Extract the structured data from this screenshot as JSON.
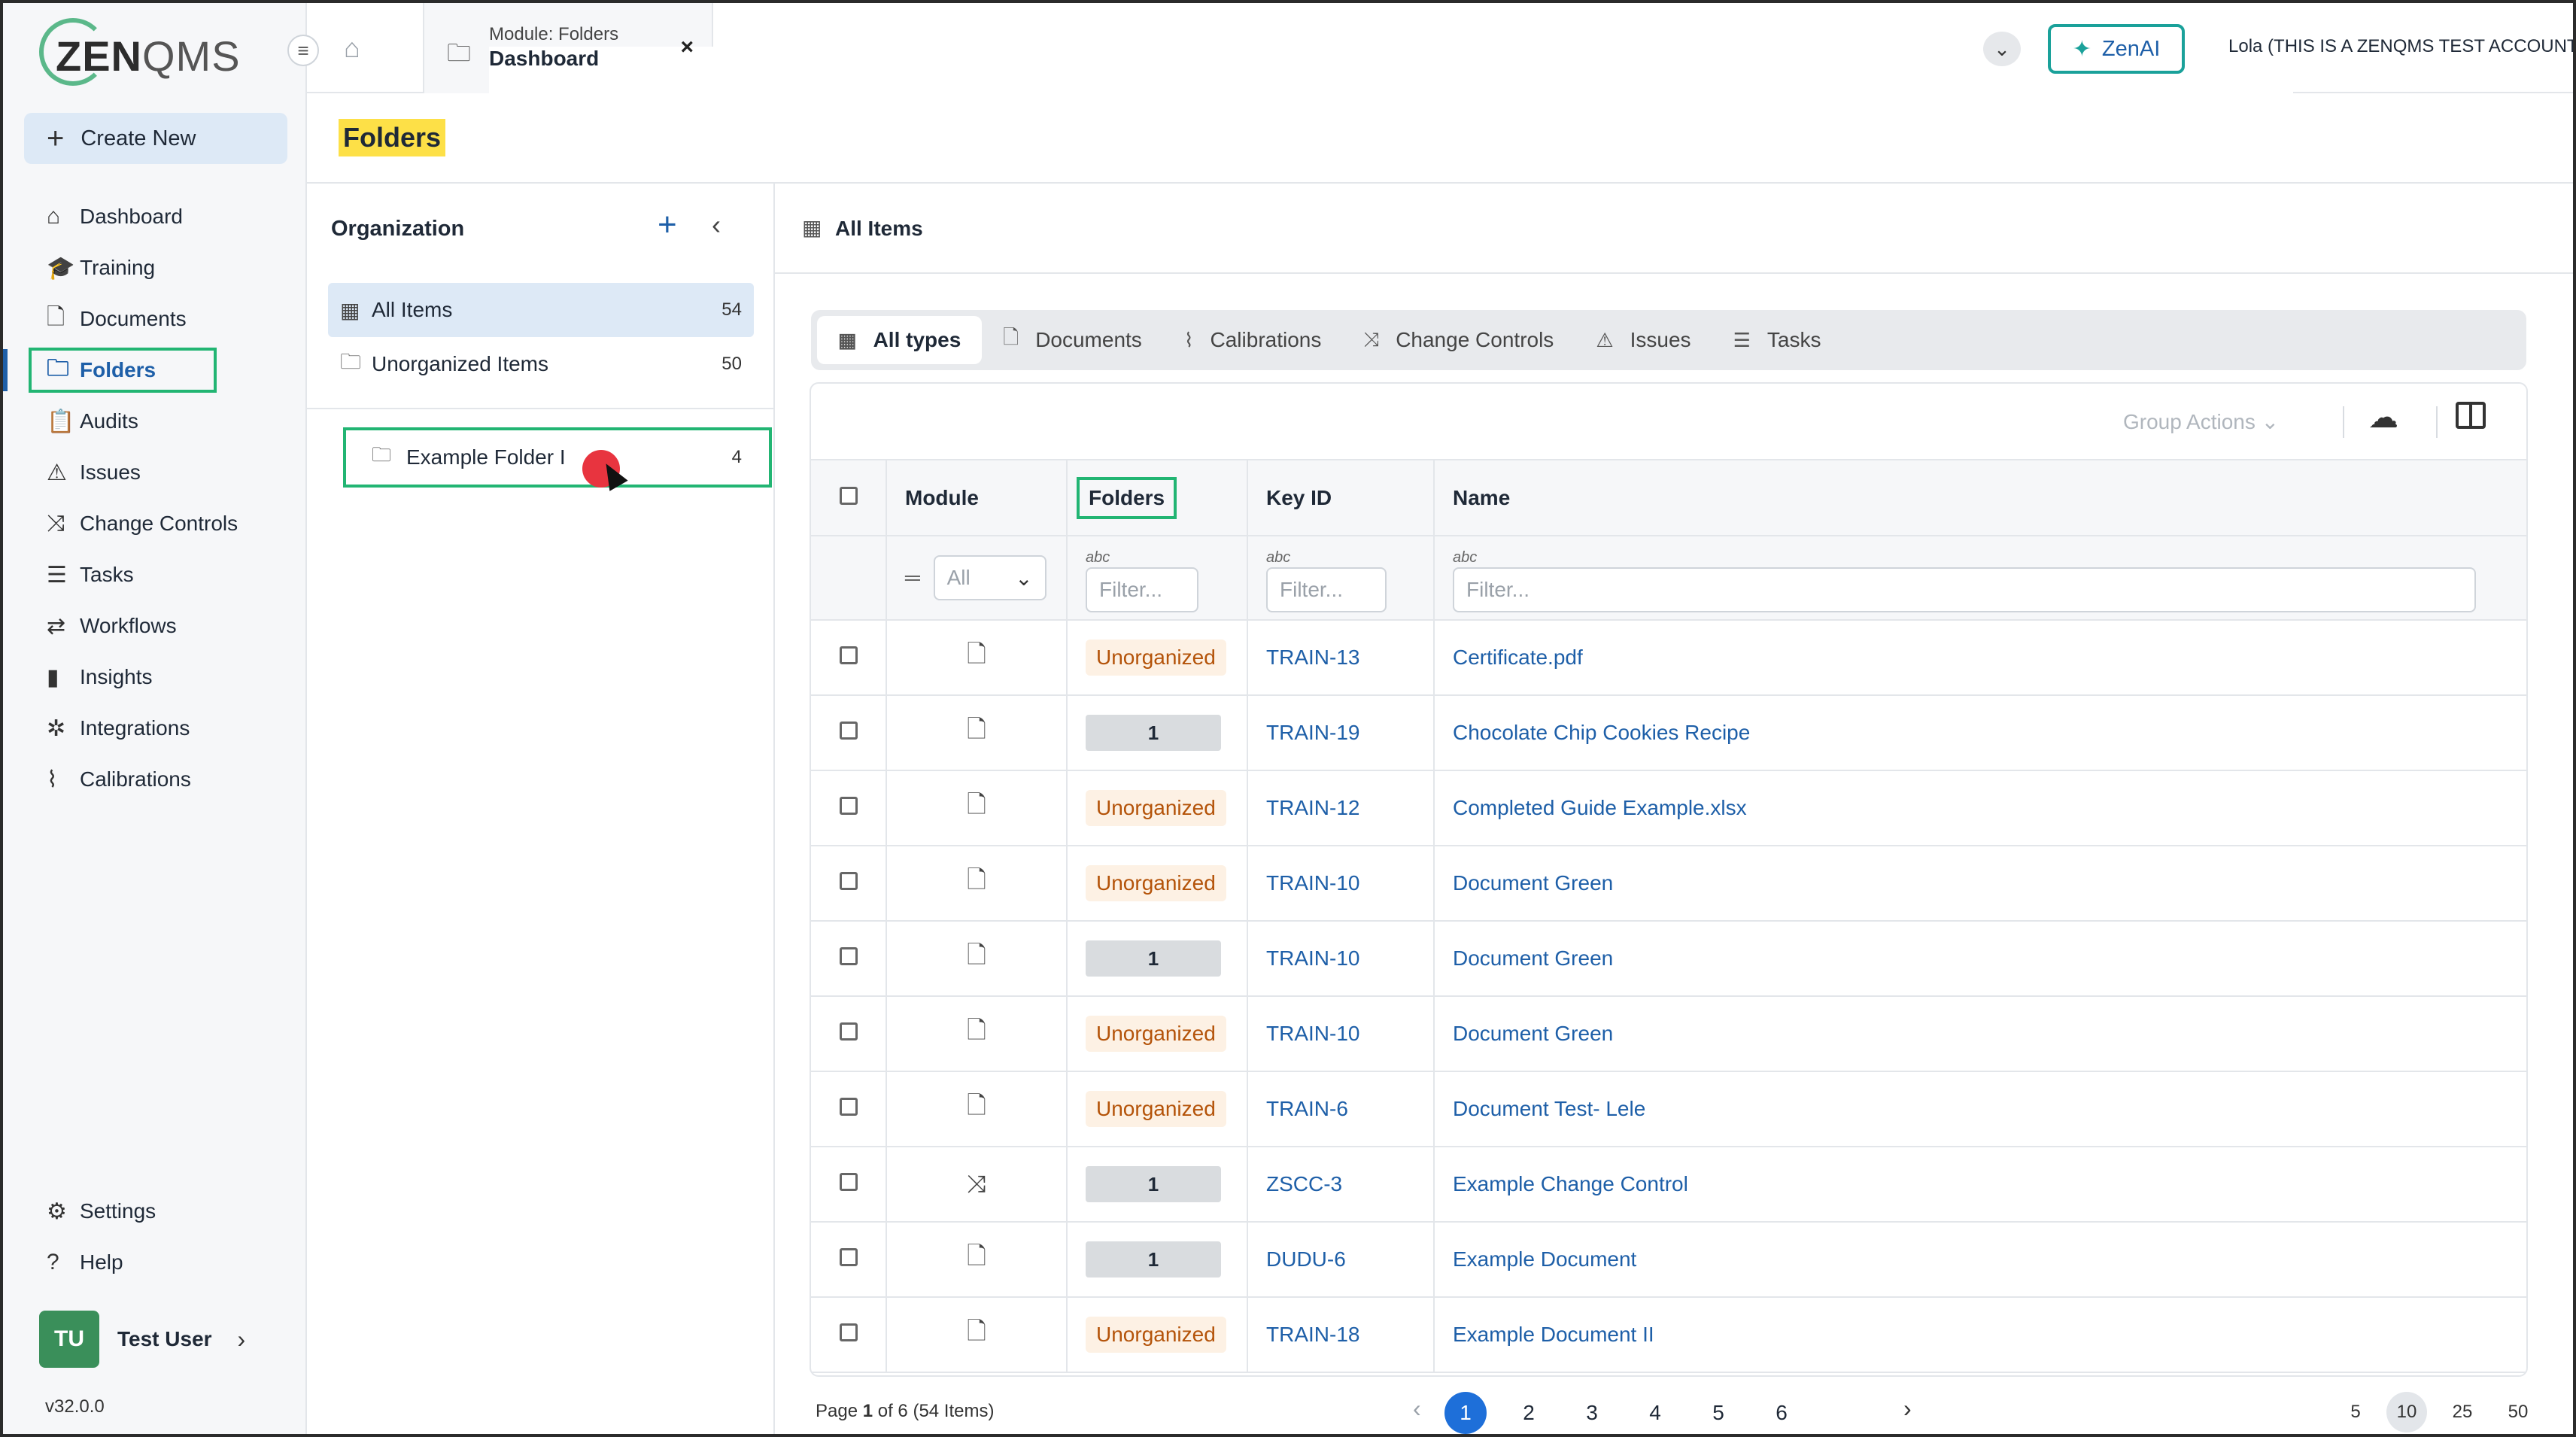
{
  "brand": {
    "logo_main": "ZEN",
    "logo_light": "QMS"
  },
  "sidebar": {
    "create_new": "Create New",
    "items": [
      {
        "label": "Dashboard",
        "icon": "home-icon"
      },
      {
        "label": "Training",
        "icon": "graduation-cap-icon"
      },
      {
        "label": "Documents",
        "icon": "document-icon"
      },
      {
        "label": "Folders",
        "icon": "folder-icon",
        "active": true
      },
      {
        "label": "Audits",
        "icon": "clipboard-icon"
      },
      {
        "label": "Issues",
        "icon": "warning-icon"
      },
      {
        "label": "Change Controls",
        "icon": "shuffle-icon"
      },
      {
        "label": "Tasks",
        "icon": "checklist-icon"
      },
      {
        "label": "Workflows",
        "icon": "workflow-icon"
      },
      {
        "label": "Insights",
        "icon": "chart-icon"
      },
      {
        "label": "Integrations",
        "icon": "network-icon"
      },
      {
        "label": "Calibrations",
        "icon": "line-chart-icon"
      }
    ],
    "bottom": [
      {
        "label": "Settings",
        "icon": "gear-icon"
      },
      {
        "label": "Help",
        "icon": "help-icon"
      }
    ],
    "user": {
      "initials": "TU",
      "name": "Test User"
    },
    "version": "v32.0.0"
  },
  "topbar": {
    "tab_sub": "Module: Folders",
    "tab_main": "Dashboard",
    "close": "×",
    "zenai": "ZenAI",
    "account": "Lola (THIS IS A ZENQMS TEST ACCOUNT)"
  },
  "page": {
    "title": "Folders"
  },
  "org": {
    "heading": "Organization",
    "items": [
      {
        "label": "All Items",
        "count": "54"
      },
      {
        "label": "Unorganized Items",
        "count": "50"
      }
    ],
    "folder": {
      "label": "Example Folder I",
      "count": "4"
    }
  },
  "main": {
    "heading": "All Items",
    "types": [
      "All types",
      "Documents",
      "Calibrations",
      "Change Controls",
      "Issues",
      "Tasks"
    ],
    "group_actions": "Group Actions",
    "columns": {
      "module": "Module",
      "folders": "Folders",
      "key": "Key ID",
      "name": "Name"
    },
    "filters": {
      "module": "All",
      "placeholder": "Filter..."
    },
    "rows": [
      {
        "module": "doc",
        "folder": "Unorganized",
        "key": "TRAIN-13",
        "name": "Certificate.pdf"
      },
      {
        "module": "doc",
        "folder": "1",
        "key": "TRAIN-19",
        "name": "Chocolate Chip Cookies Recipe"
      },
      {
        "module": "doc",
        "folder": "Unorganized",
        "key": "TRAIN-12",
        "name": "Completed Guide Example.xlsx"
      },
      {
        "module": "doc",
        "folder": "Unorganized",
        "key": "TRAIN-10",
        "name": "Document Green"
      },
      {
        "module": "doc",
        "folder": "1",
        "key": "TRAIN-10",
        "name": "Document Green"
      },
      {
        "module": "doc",
        "folder": "Unorganized",
        "key": "TRAIN-10",
        "name": "Document Green"
      },
      {
        "module": "doc",
        "folder": "Unorganized",
        "key": "TRAIN-6",
        "name": "Document Test- Lele"
      },
      {
        "module": "cc",
        "folder": "1",
        "key": "ZSCC-3",
        "name": "Example Change Control"
      },
      {
        "module": "doc",
        "folder": "1",
        "key": "DUDU-6",
        "name": "Example Document"
      },
      {
        "module": "doc",
        "folder": "Unorganized",
        "key": "TRAIN-18",
        "name": "Example Document II"
      }
    ],
    "pager": {
      "info_prefix": "Page ",
      "info_page": "1",
      "info_suffix": " of 6 (54 Items)",
      "pages": [
        "1",
        "2",
        "3",
        "4",
        "5",
        "6"
      ],
      "current": "1",
      "sizes": [
        "5",
        "10",
        "25",
        "50"
      ],
      "size_current": "10"
    }
  }
}
